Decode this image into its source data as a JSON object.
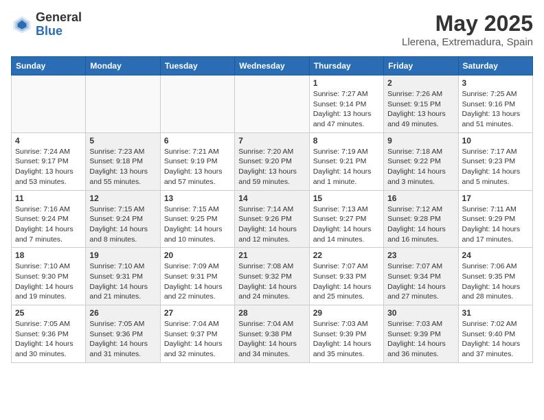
{
  "header": {
    "logo_general": "General",
    "logo_blue": "Blue",
    "month_title": "May 2025",
    "subtitle": "Llerena, Extremadura, Spain"
  },
  "days_of_week": [
    "Sunday",
    "Monday",
    "Tuesday",
    "Wednesday",
    "Thursday",
    "Friday",
    "Saturday"
  ],
  "weeks": [
    [
      {
        "num": "",
        "info": "",
        "empty": true
      },
      {
        "num": "",
        "info": "",
        "empty": true
      },
      {
        "num": "",
        "info": "",
        "empty": true
      },
      {
        "num": "",
        "info": "",
        "empty": true
      },
      {
        "num": "1",
        "info": "Sunrise: 7:27 AM\nSunset: 9:14 PM\nDaylight: 13 hours\nand 47 minutes.",
        "shaded": false
      },
      {
        "num": "2",
        "info": "Sunrise: 7:26 AM\nSunset: 9:15 PM\nDaylight: 13 hours\nand 49 minutes.",
        "shaded": true
      },
      {
        "num": "3",
        "info": "Sunrise: 7:25 AM\nSunset: 9:16 PM\nDaylight: 13 hours\nand 51 minutes.",
        "shaded": false
      }
    ],
    [
      {
        "num": "4",
        "info": "Sunrise: 7:24 AM\nSunset: 9:17 PM\nDaylight: 13 hours\nand 53 minutes.",
        "shaded": false
      },
      {
        "num": "5",
        "info": "Sunrise: 7:23 AM\nSunset: 9:18 PM\nDaylight: 13 hours\nand 55 minutes.",
        "shaded": true
      },
      {
        "num": "6",
        "info": "Sunrise: 7:21 AM\nSunset: 9:19 PM\nDaylight: 13 hours\nand 57 minutes.",
        "shaded": false
      },
      {
        "num": "7",
        "info": "Sunrise: 7:20 AM\nSunset: 9:20 PM\nDaylight: 13 hours\nand 59 minutes.",
        "shaded": true
      },
      {
        "num": "8",
        "info": "Sunrise: 7:19 AM\nSunset: 9:21 PM\nDaylight: 14 hours\nand 1 minute.",
        "shaded": false
      },
      {
        "num": "9",
        "info": "Sunrise: 7:18 AM\nSunset: 9:22 PM\nDaylight: 14 hours\nand 3 minutes.",
        "shaded": true
      },
      {
        "num": "10",
        "info": "Sunrise: 7:17 AM\nSunset: 9:23 PM\nDaylight: 14 hours\nand 5 minutes.",
        "shaded": false
      }
    ],
    [
      {
        "num": "11",
        "info": "Sunrise: 7:16 AM\nSunset: 9:24 PM\nDaylight: 14 hours\nand 7 minutes.",
        "shaded": false
      },
      {
        "num": "12",
        "info": "Sunrise: 7:15 AM\nSunset: 9:24 PM\nDaylight: 14 hours\nand 8 minutes.",
        "shaded": true
      },
      {
        "num": "13",
        "info": "Sunrise: 7:15 AM\nSunset: 9:25 PM\nDaylight: 14 hours\nand 10 minutes.",
        "shaded": false
      },
      {
        "num": "14",
        "info": "Sunrise: 7:14 AM\nSunset: 9:26 PM\nDaylight: 14 hours\nand 12 minutes.",
        "shaded": true
      },
      {
        "num": "15",
        "info": "Sunrise: 7:13 AM\nSunset: 9:27 PM\nDaylight: 14 hours\nand 14 minutes.",
        "shaded": false
      },
      {
        "num": "16",
        "info": "Sunrise: 7:12 AM\nSunset: 9:28 PM\nDaylight: 14 hours\nand 16 minutes.",
        "shaded": true
      },
      {
        "num": "17",
        "info": "Sunrise: 7:11 AM\nSunset: 9:29 PM\nDaylight: 14 hours\nand 17 minutes.",
        "shaded": false
      }
    ],
    [
      {
        "num": "18",
        "info": "Sunrise: 7:10 AM\nSunset: 9:30 PM\nDaylight: 14 hours\nand 19 minutes.",
        "shaded": false
      },
      {
        "num": "19",
        "info": "Sunrise: 7:10 AM\nSunset: 9:31 PM\nDaylight: 14 hours\nand 21 minutes.",
        "shaded": true
      },
      {
        "num": "20",
        "info": "Sunrise: 7:09 AM\nSunset: 9:31 PM\nDaylight: 14 hours\nand 22 minutes.",
        "shaded": false
      },
      {
        "num": "21",
        "info": "Sunrise: 7:08 AM\nSunset: 9:32 PM\nDaylight: 14 hours\nand 24 minutes.",
        "shaded": true
      },
      {
        "num": "22",
        "info": "Sunrise: 7:07 AM\nSunset: 9:33 PM\nDaylight: 14 hours\nand 25 minutes.",
        "shaded": false
      },
      {
        "num": "23",
        "info": "Sunrise: 7:07 AM\nSunset: 9:34 PM\nDaylight: 14 hours\nand 27 minutes.",
        "shaded": true
      },
      {
        "num": "24",
        "info": "Sunrise: 7:06 AM\nSunset: 9:35 PM\nDaylight: 14 hours\nand 28 minutes.",
        "shaded": false
      }
    ],
    [
      {
        "num": "25",
        "info": "Sunrise: 7:05 AM\nSunset: 9:36 PM\nDaylight: 14 hours\nand 30 minutes.",
        "shaded": false
      },
      {
        "num": "26",
        "info": "Sunrise: 7:05 AM\nSunset: 9:36 PM\nDaylight: 14 hours\nand 31 minutes.",
        "shaded": true
      },
      {
        "num": "27",
        "info": "Sunrise: 7:04 AM\nSunset: 9:37 PM\nDaylight: 14 hours\nand 32 minutes.",
        "shaded": false
      },
      {
        "num": "28",
        "info": "Sunrise: 7:04 AM\nSunset: 9:38 PM\nDaylight: 14 hours\nand 34 minutes.",
        "shaded": true
      },
      {
        "num": "29",
        "info": "Sunrise: 7:03 AM\nSunset: 9:39 PM\nDaylight: 14 hours\nand 35 minutes.",
        "shaded": false
      },
      {
        "num": "30",
        "info": "Sunrise: 7:03 AM\nSunset: 9:39 PM\nDaylight: 14 hours\nand 36 minutes.",
        "shaded": true
      },
      {
        "num": "31",
        "info": "Sunrise: 7:02 AM\nSunset: 9:40 PM\nDaylight: 14 hours\nand 37 minutes.",
        "shaded": false
      }
    ]
  ]
}
